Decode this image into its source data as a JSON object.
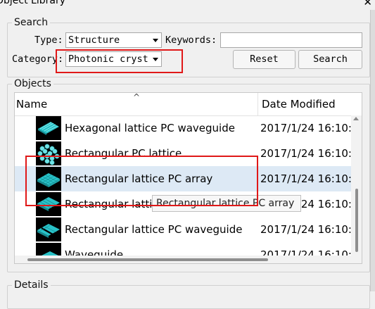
{
  "window": {
    "title": "Object Library",
    "close_glyph": "✕"
  },
  "search": {
    "legend": "Search",
    "type_label": "Type:",
    "type_value": "Structure",
    "keywords_label": "Keywords:",
    "keywords_value": "",
    "category_label": "Category:",
    "category_value": "Photonic cryst",
    "reset_label": "Reset",
    "search_label": "Search"
  },
  "objects": {
    "legend": "Objects",
    "columns": {
      "name": "Name",
      "date": "Date Modified"
    },
    "rows": [
      {
        "name": "Hexagonal lattice PC waveguide",
        "date": "2017/1/24 16:10:",
        "icon": "hex-waveguide-thumb",
        "selected": false
      },
      {
        "name": "Rectangular PC lattice",
        "date": "2017/1/24 16:10:",
        "icon": "rod-lattice-thumb",
        "selected": false
      },
      {
        "name": "Rectangular lattice PC array",
        "date": "2017/1/24 16:10:",
        "icon": "rect-array-thumb",
        "selected": true
      },
      {
        "name": "Rectangular lattice",
        "date": "2017/1/24 16:10:",
        "icon": "rect-lattice-thumb",
        "selected": false
      },
      {
        "name": "Rectangular lattice PC waveguide",
        "date": "2017/1/24 16:10:",
        "icon": "rect-waveguide-thumb",
        "selected": false
      },
      {
        "name": "Waveguide",
        "date": "2017/1/24 16:10:",
        "icon": "waveguide-thumb",
        "selected": false
      }
    ],
    "tooltip": "Rectangular lattice PC array"
  },
  "details": {
    "legend": "Details"
  },
  "colors": {
    "highlight": "#e01818",
    "selection": "#dde9f5",
    "thumb_fill": "#29c2c8"
  }
}
